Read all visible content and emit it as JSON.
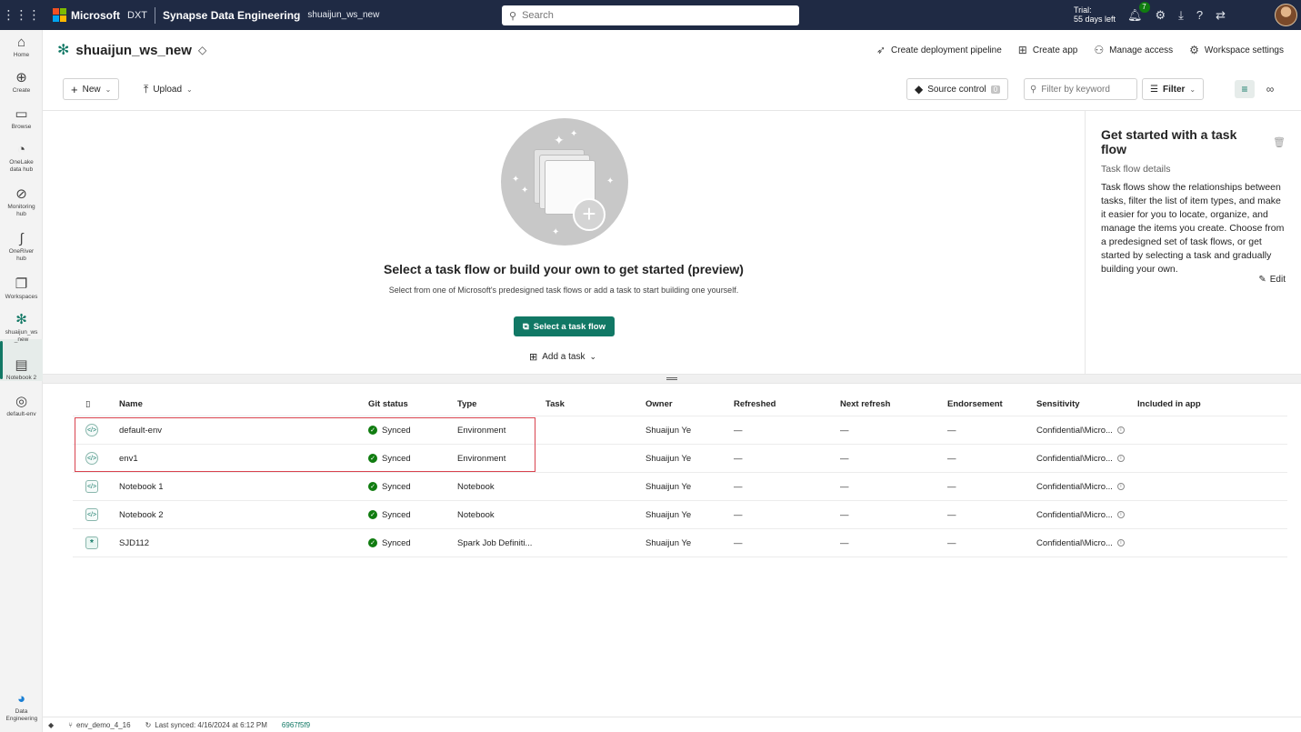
{
  "topbar": {
    "brand": "Microsoft",
    "brand_sub": "DXT",
    "product": "Synapse Data Engineering",
    "workspace": "shuaijun_ws_new",
    "search_placeholder": "Search",
    "trial_line1": "Trial:",
    "trial_line2": "55 days left",
    "notif_count": "7"
  },
  "rail": {
    "items": [
      {
        "label": "Home",
        "icon": "home-icon"
      },
      {
        "label": "Create",
        "icon": "plus-circle-icon"
      },
      {
        "label": "Browse",
        "icon": "folder-icon"
      },
      {
        "label": "OneLake data hub",
        "icon": "onelake-icon"
      },
      {
        "label": "Monitoring hub",
        "icon": "monitor-icon"
      },
      {
        "label": "OneRiver hub",
        "icon": "river-icon"
      },
      {
        "label": "Workspaces",
        "icon": "workspaces-icon"
      },
      {
        "label": "shuaijun_ws _new",
        "icon": "workspace-icon"
      },
      {
        "label": "Notebook 2",
        "icon": "notebook-icon"
      },
      {
        "label": "default-env",
        "icon": "environment-icon"
      }
    ],
    "bottom_label": "Data Engineering"
  },
  "workspace": {
    "title": "shuaijun_ws_new",
    "actions": {
      "pipeline": "Create deployment pipeline",
      "app": "Create app",
      "access": "Manage access",
      "settings": "Workspace settings"
    }
  },
  "toolbar": {
    "new_label": "New",
    "upload_label": "Upload",
    "source_control_label": "Source control",
    "source_control_count": "0",
    "filter_placeholder": "Filter by keyword",
    "filter_label": "Filter"
  },
  "taskflow": {
    "title": "Select a task flow or build your own to get started (preview)",
    "subtitle": "Select from one of Microsoft's predesigned task flows or add a task to start building one yourself.",
    "primary_button": "Select a task flow",
    "add_task": "Add a task"
  },
  "panel": {
    "title": "Get started with a task flow",
    "subtitle": "Task flow details",
    "body": "Task flows show the relationships between tasks, filter the list of item types, and make it easier for you to locate, organize, and manage the items you create. Choose from a predesigned set of task flows, or get started by selecting a task and gradually building your own.",
    "edit_label": "Edit"
  },
  "table": {
    "headers": {
      "name": "Name",
      "git": "Git status",
      "type": "Type",
      "task": "Task",
      "owner": "Owner",
      "refreshed": "Refreshed",
      "next": "Next refresh",
      "endorsement": "Endorsement",
      "sensitivity": "Sensitivity",
      "app": "Included in app"
    },
    "rows": [
      {
        "name": "default-env",
        "icon": "environment-icon",
        "git": "Synced",
        "type": "Environment",
        "task": "",
        "owner": "Shuaijun Ye",
        "refreshed": "—",
        "next": "—",
        "endorsement": "—",
        "sensitivity": "Confidential\\Micro...",
        "app": ""
      },
      {
        "name": "env1",
        "icon": "environment-icon",
        "git": "Synced",
        "type": "Environment",
        "task": "",
        "owner": "Shuaijun Ye",
        "refreshed": "—",
        "next": "—",
        "endorsement": "—",
        "sensitivity": "Confidential\\Micro...",
        "app": ""
      },
      {
        "name": "Notebook 1",
        "icon": "notebook-icon",
        "git": "Synced",
        "type": "Notebook",
        "task": "",
        "owner": "Shuaijun Ye",
        "refreshed": "—",
        "next": "—",
        "endorsement": "—",
        "sensitivity": "Confidential\\Micro...",
        "app": ""
      },
      {
        "name": "Notebook 2",
        "icon": "notebook-icon",
        "git": "Synced",
        "type": "Notebook",
        "task": "",
        "owner": "Shuaijun Ye",
        "refreshed": "—",
        "next": "—",
        "endorsement": "—",
        "sensitivity": "Confidential\\Micro...",
        "app": ""
      },
      {
        "name": "SJD112",
        "icon": "spark-job-icon",
        "git": "Synced",
        "type": "Spark Job Definiti...",
        "task": "",
        "owner": "Shuaijun Ye",
        "refreshed": "—",
        "next": "—",
        "endorsement": "—",
        "sensitivity": "Confidential\\Micro...",
        "app": ""
      }
    ]
  },
  "statusbar": {
    "branch": "env_demo_4_16",
    "last_synced": "Last synced: 4/16/2024 at 6:12 PM",
    "commit": "6967f5f9"
  },
  "colors": {
    "topbar": "#1f2a44",
    "accent": "#117865",
    "synced": "#107c10",
    "highlight": "#d9434f"
  }
}
